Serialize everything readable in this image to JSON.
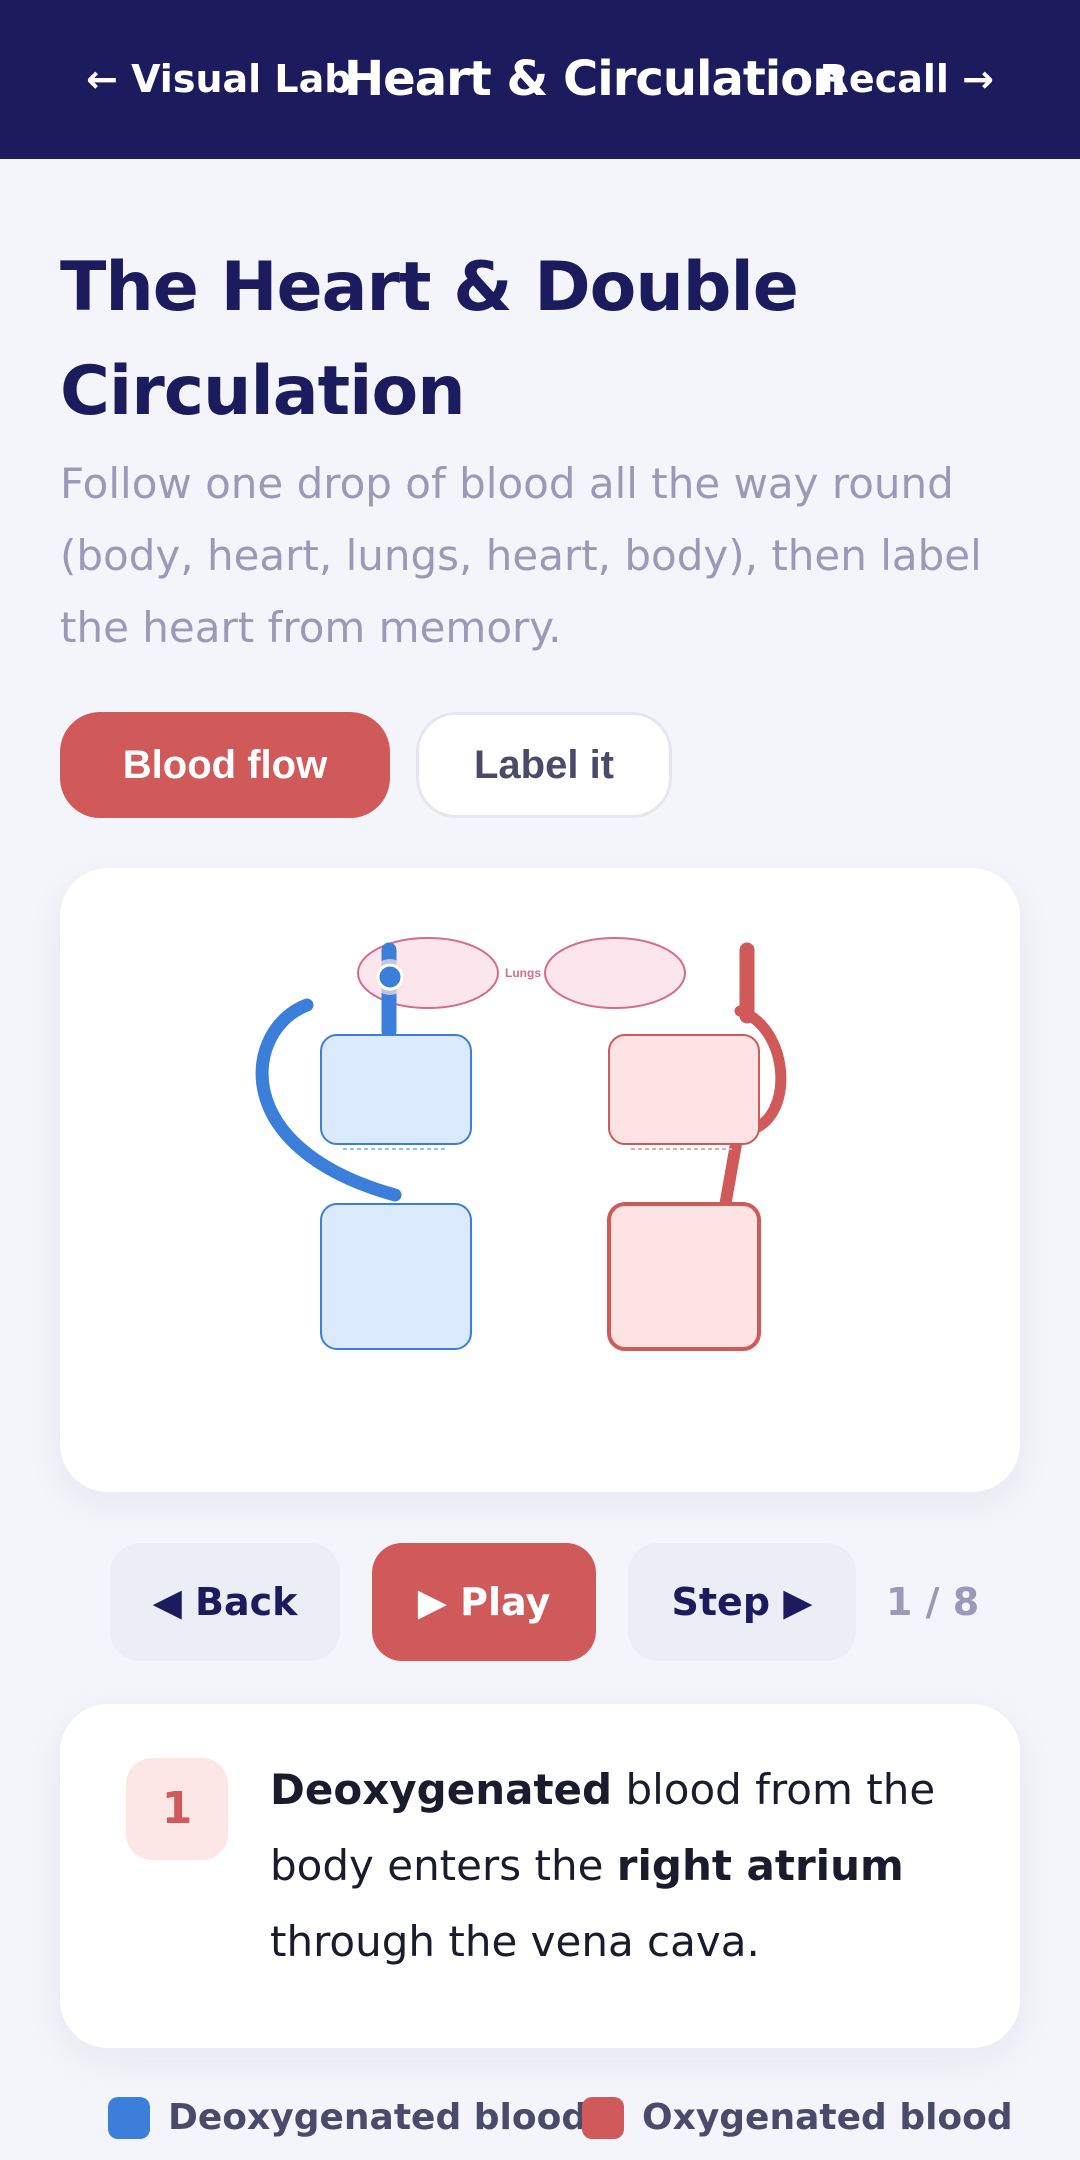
{
  "header": {
    "back_link": "← Visual Lab",
    "title": "Heart & Circulation",
    "next_link": "Recall →"
  },
  "page": {
    "title": "The Heart & Double Circulation",
    "subtitle": "Follow one drop of blood all the way round (body, heart, lungs, heart, body), then label the heart from memory."
  },
  "modes": {
    "flow_label": "Blood flow",
    "label_label": "Label it",
    "active": "Blood flow"
  },
  "diagram": {
    "lungs_label": "Lungs"
  },
  "controls": {
    "back_label": "◀ Back",
    "play_label": "▶ Play",
    "step_label": "Step ▶",
    "counter": "1 / 8"
  },
  "step": {
    "number": "1",
    "text_bold_1": "Deoxygenated",
    "text_1": " blood from the body enters the ",
    "text_bold_2": "right atrium",
    "text_2": " through the vena cava."
  },
  "legend": {
    "deoxy_label": "Deoxygenated blood",
    "deoxy_color": "#3b7fdb",
    "oxy_label": "Oxygenated blood",
    "oxy_color": "#d05a5a"
  }
}
